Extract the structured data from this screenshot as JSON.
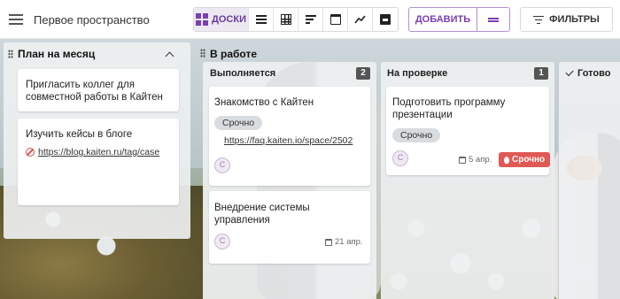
{
  "header": {
    "space_title": "Первое пространство",
    "views": {
      "boards_label": "ДОСКИ",
      "active": "boards",
      "icons": [
        "boards-icon",
        "list-icon",
        "table-icon",
        "timeline-icon",
        "calendar-icon",
        "chart-icon",
        "archive-icon"
      ]
    },
    "add_label": "ДОБАВИТЬ",
    "filters_label": "ФИЛЬТРЫ",
    "accent_color": "#7a3fb0"
  },
  "plan_column": {
    "title": "План на месяц",
    "cards": [
      {
        "title": "Пригласить коллег для совместной работы в Кайтен"
      },
      {
        "title": "Изучить кейсы в блоге",
        "link": "https://blog.kaiten.ru/tag/case"
      }
    ]
  },
  "board": {
    "title": "В работе",
    "columns": [
      {
        "name": "Выполняется",
        "count": "2",
        "cards": [
          {
            "title": "Знакомство с Кайтен",
            "tag": "Срочно",
            "link": "https://faq.kaiten.io/space/2502",
            "avatar": "C"
          },
          {
            "title": "Внедрение системы управления",
            "date": "21 апр.",
            "avatar": "C"
          }
        ]
      },
      {
        "name": "На проверке",
        "count": "1",
        "cards": [
          {
            "title": "Подготовить программу презентации",
            "tag": "Срочно",
            "date": "5 апр.",
            "badge": "Срочно",
            "avatar": "C",
            "badge_color": "#e05a55"
          }
        ]
      },
      {
        "name": "Готово"
      }
    ]
  }
}
